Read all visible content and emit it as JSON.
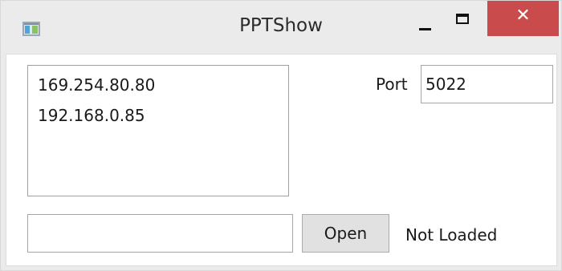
{
  "window": {
    "title": "PPTShow",
    "app_icon": "presentation-window-icon",
    "controls": {
      "minimize_icon": "minimize-icon",
      "maximize_icon": "maximize-icon",
      "close_icon": "close-icon",
      "close_glyph": "✕",
      "close_color": "#c94b4b"
    }
  },
  "addresses": {
    "items": [
      "169.254.80.80",
      "192.168.0.85"
    ]
  },
  "port": {
    "label": "Port",
    "value": "5022"
  },
  "file": {
    "value": "",
    "placeholder": ""
  },
  "actions": {
    "open_label": "Open"
  },
  "status": {
    "text": "Not Loaded"
  }
}
